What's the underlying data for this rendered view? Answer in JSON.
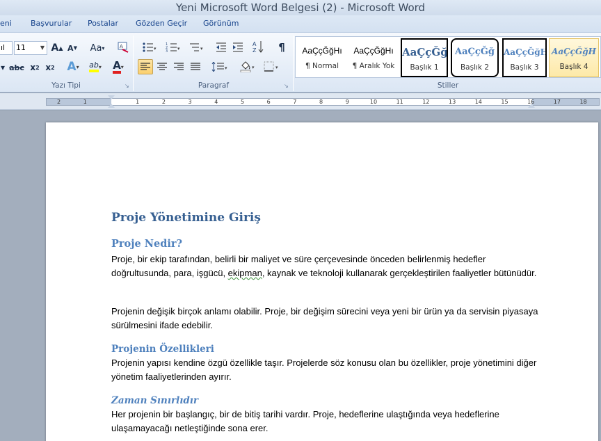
{
  "window": {
    "title": "Yeni Microsoft Word Belgesi (2)  -  Microsoft Word"
  },
  "tabs": [
    "eni",
    "Başvurular",
    "Postalar",
    "Gözden Geçir",
    "Görünüm"
  ],
  "ribbon": {
    "font_name": "ıl",
    "font_size": "11",
    "groups": {
      "font": "Yazı Tipi",
      "paragraph": "Paragraf",
      "styles": "Stiller"
    },
    "font_buttons": {
      "grow": "A",
      "shrink": "A",
      "case": "Aa",
      "strike": "abc",
      "subscript": "x",
      "subscript_sub": "2",
      "superscript": "x",
      "superscript_sup": "2",
      "effects": "A",
      "highlight": "ab",
      "font_color": "A"
    },
    "colors": {
      "highlight": "#ffff00",
      "font_color": "#e02020",
      "accent": "#365f91"
    },
    "styles": [
      {
        "sample": "AaÇçĞğHı",
        "name": "¶ Normal"
      },
      {
        "sample": "AaÇçĞğHı",
        "name": "¶ Aralık Yok"
      },
      {
        "sample": "AaÇçĞğ",
        "name": "Başlık 1"
      },
      {
        "sample": "AaÇçĞğ",
        "name": "Başlık 2"
      },
      {
        "sample": "AaÇçĞğH",
        "name": "Başlık 3"
      },
      {
        "sample": "AaÇçĞğH",
        "name": "Başlık 4"
      }
    ]
  },
  "ruler": {
    "ticks": [
      "2",
      "1",
      "1",
      "2",
      "3",
      "4",
      "5",
      "6",
      "7",
      "8",
      "9",
      "10",
      "11",
      "12",
      "13",
      "14",
      "15",
      "16",
      "17",
      "18"
    ]
  },
  "document": {
    "title": "Proje Yönetimine Giriş",
    "h2": "Proje Nedir?",
    "p1_a": "Proje, bir ekip tarafından, belirli bir maliyet ve süre çerçevesinde önceden belirlenmiş hedefler doğrultusunda, para, işgücü, ",
    "p1_b": "ekipman",
    "p1_c": ", kaynak ve teknoloji kullanarak gerçekleştirilen faaliyetler bütünüdür.",
    "p2": "Projenin değişik birçok anlamı olabilir.  Proje, bir değişim sürecini veya yeni bir ürün ya da servisin piyasaya sürülmesini ifade edebilir.",
    "h3": "Projenin Özellikleri",
    "p3": "Projenin yapısı kendine özgü özellikle taşır. Projelerde söz konusu olan bu özellikler, proje yönetimini diğer yönetim faaliyetlerinden ayırır.",
    "h4": "Zaman Sınırlıdır",
    "p4": "Her projenin bir başlangıç, bir de bitiş tarihi vardır. Proje, hedeflerine ulaştığında veya hedeflerine ulaşamayacağı netleştiğinde sona erer."
  }
}
